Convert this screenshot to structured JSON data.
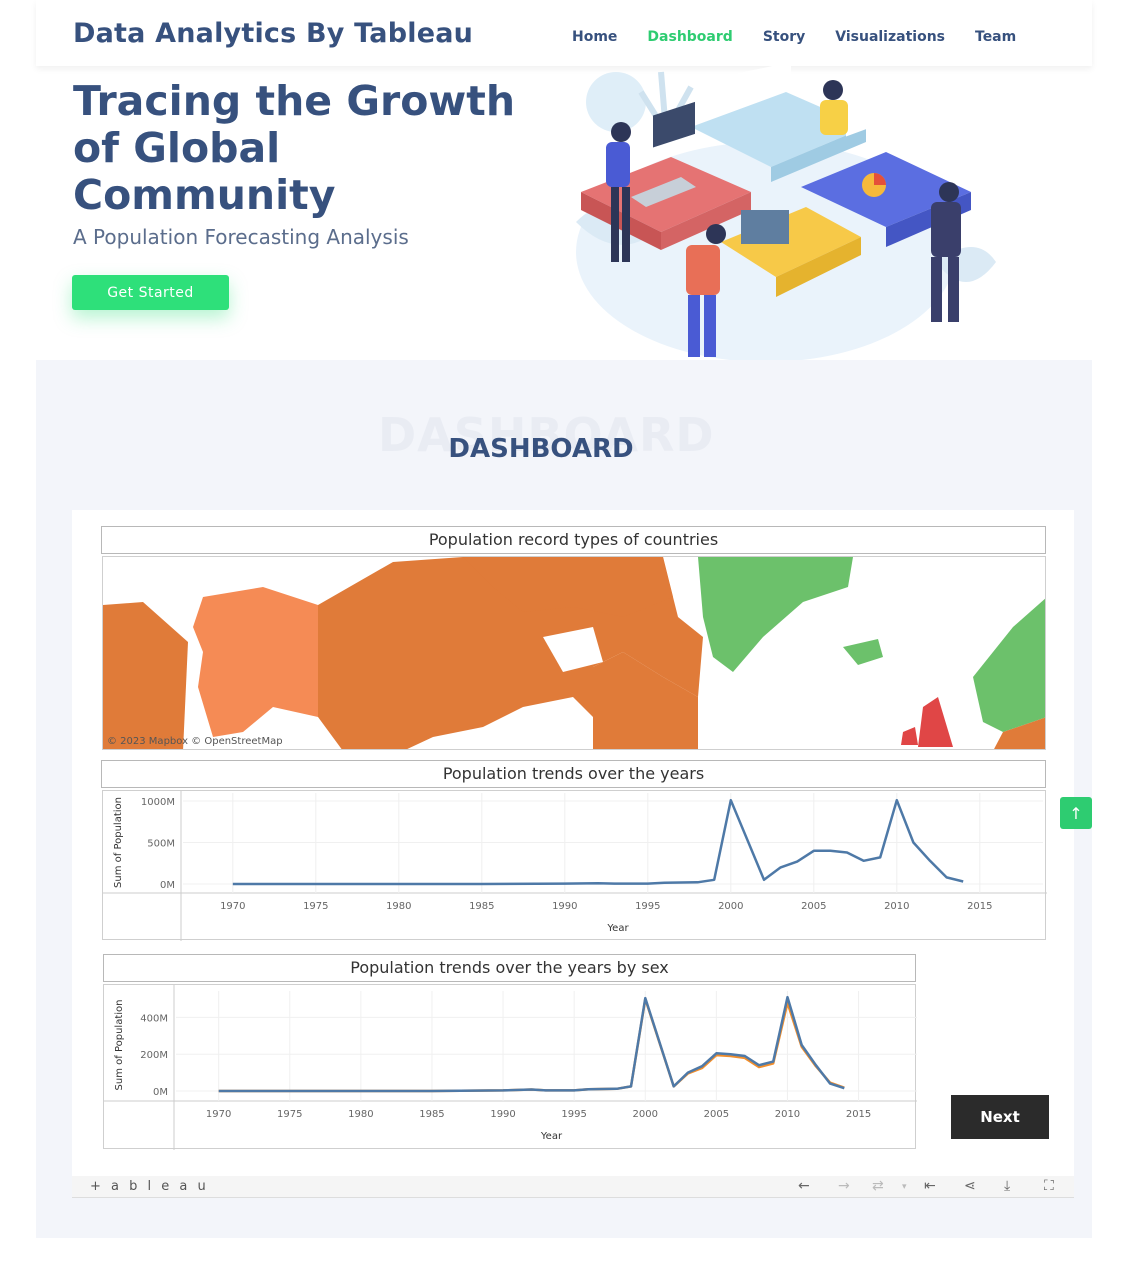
{
  "header": {
    "brand": "Data Analytics By Tableau",
    "nav": [
      "Home",
      "Dashboard",
      "Story",
      "Visualizations",
      "Team"
    ],
    "active": "Dashboard"
  },
  "hero": {
    "title": "Tracing the Growth of Global Community",
    "subtitle": "A Population Forecasting Analysis",
    "cta": "Get Started"
  },
  "section": {
    "ghost": "DASHBOARD",
    "title": "DASHBOARD"
  },
  "dashboard": {
    "map_title": "Population record types of countries",
    "map_attribution": "© 2023 Mapbox  © OpenStreetMap",
    "trend_title": "Population trends over the years",
    "sex_title": "Population trends over the years by sex",
    "next_label": "Next",
    "tableau_logo": "+ a b l e a u"
  },
  "colors": {
    "accent": "#2ecc71",
    "brand": "#37517e",
    "series_main": "#4e79a7",
    "series_second": "#f28e2b"
  },
  "chart_data": [
    {
      "type": "line",
      "title": "Population trends over the years",
      "xlabel": "Year",
      "ylabel": "Sum of Population",
      "x_ticks": [
        "1970",
        "1975",
        "1980",
        "1985",
        "1990",
        "1995",
        "2000",
        "2005",
        "2010",
        "2015"
      ],
      "y_ticks": [
        "0M",
        "500M",
        "1000M"
      ],
      "ylim": [
        0,
        1000
      ],
      "x": [
        1970,
        1975,
        1980,
        1985,
        1990,
        1992,
        1993,
        1995,
        1996,
        1998,
        1999,
        2000,
        2002,
        2003,
        2004,
        2005,
        2006,
        2007,
        2008,
        2009,
        2010,
        2011,
        2012,
        2013,
        2014
      ],
      "series": [
        {
          "values": [
            0,
            0,
            0,
            0,
            5,
            10,
            5,
            5,
            15,
            20,
            50,
            1010,
            50,
            200,
            270,
            400,
            400,
            380,
            280,
            320,
            1010,
            500,
            280,
            80,
            30
          ]
        }
      ]
    },
    {
      "type": "line",
      "title": "Population trends over the years by sex",
      "xlabel": "Year",
      "ylabel": "Sum of Population",
      "x_ticks": [
        "1970",
        "1975",
        "1980",
        "1985",
        "1990",
        "1995",
        "2000",
        "2005",
        "2010",
        "2015"
      ],
      "y_ticks": [
        "0M",
        "200M",
        "400M"
      ],
      "ylim": [
        0,
        500
      ],
      "x": [
        1970,
        1975,
        1980,
        1985,
        1990,
        1992,
        1993,
        1995,
        1996,
        1998,
        1999,
        2000,
        2002,
        2003,
        2004,
        2005,
        2006,
        2007,
        2008,
        2009,
        2010,
        2011,
        2012,
        2013,
        2014
      ],
      "series": [
        {
          "values": [
            0,
            0,
            0,
            0,
            3,
            8,
            3,
            3,
            10,
            12,
            25,
            505,
            25,
            100,
            135,
            205,
            200,
            190,
            140,
            160,
            510,
            250,
            140,
            40,
            15
          ]
        },
        {
          "values": [
            0,
            0,
            0,
            0,
            3,
            8,
            3,
            3,
            10,
            12,
            25,
            500,
            25,
            95,
            125,
            195,
            190,
            180,
            130,
            150,
            480,
            240,
            135,
            45,
            18
          ]
        }
      ]
    }
  ]
}
